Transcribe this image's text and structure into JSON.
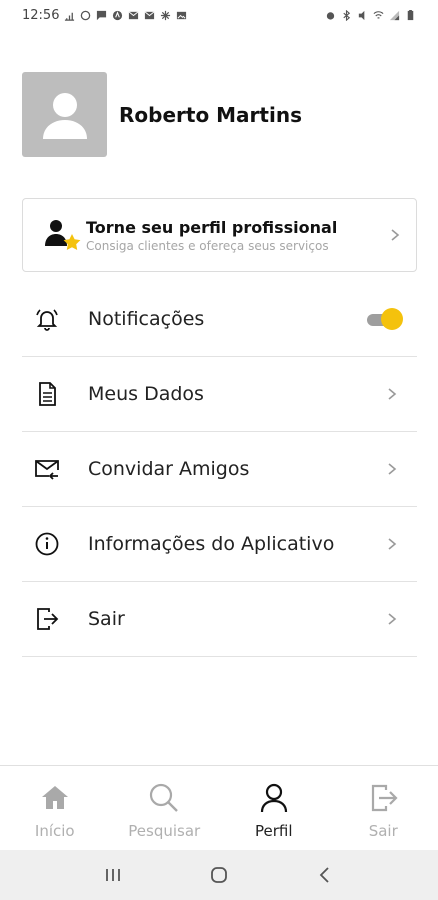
{
  "status_bar": {
    "time": "12:56",
    "left_icons": [
      "signal-data-icon",
      "whatsapp-icon",
      "message-icon",
      "app-icon",
      "mail-icon",
      "mail-icon",
      "pinwheel-icon",
      "image-icon"
    ],
    "right_icons": [
      "alarm-icon",
      "bluetooth-icon",
      "mute-icon",
      "wifi-icon",
      "signal-icon",
      "battery-icon"
    ]
  },
  "profile": {
    "name": "Roberto Martins",
    "avatar_icon": "user-avatar-icon"
  },
  "pro_card": {
    "title": "Torne seu perfil profissional",
    "subtitle": "Consiga clientes e ofereça seus serviços",
    "icon": "professional-star-icon",
    "accent": "#f4c20d"
  },
  "menu": {
    "items": [
      {
        "label": "Notificações",
        "icon": "bell-icon",
        "control": "toggle",
        "toggle_on": true
      },
      {
        "label": "Meus Dados",
        "icon": "document-icon",
        "control": "chevron"
      },
      {
        "label": "Convidar Amigos",
        "icon": "mail-invite-icon",
        "control": "chevron"
      },
      {
        "label": "Informações do Aplicativo",
        "icon": "info-icon",
        "control": "chevron"
      },
      {
        "label": "Sair",
        "icon": "logout-icon",
        "control": "chevron"
      }
    ]
  },
  "bottom_nav": {
    "items": [
      {
        "label": "Início",
        "icon": "home-icon",
        "active": false
      },
      {
        "label": "Pesquisar",
        "icon": "search-icon",
        "active": false
      },
      {
        "label": "Perfil",
        "icon": "person-icon",
        "active": true
      },
      {
        "label": "Sair",
        "icon": "logout-icon",
        "active": false
      }
    ]
  },
  "system_nav": {
    "buttons": [
      "recents-icon",
      "home-circle-icon",
      "back-icon"
    ]
  },
  "colors": {
    "accent_yellow": "#f4c20d",
    "avatar_bg": "#bdbdbd",
    "divider": "#e2e2e2",
    "inactive": "#b0b0b0"
  }
}
